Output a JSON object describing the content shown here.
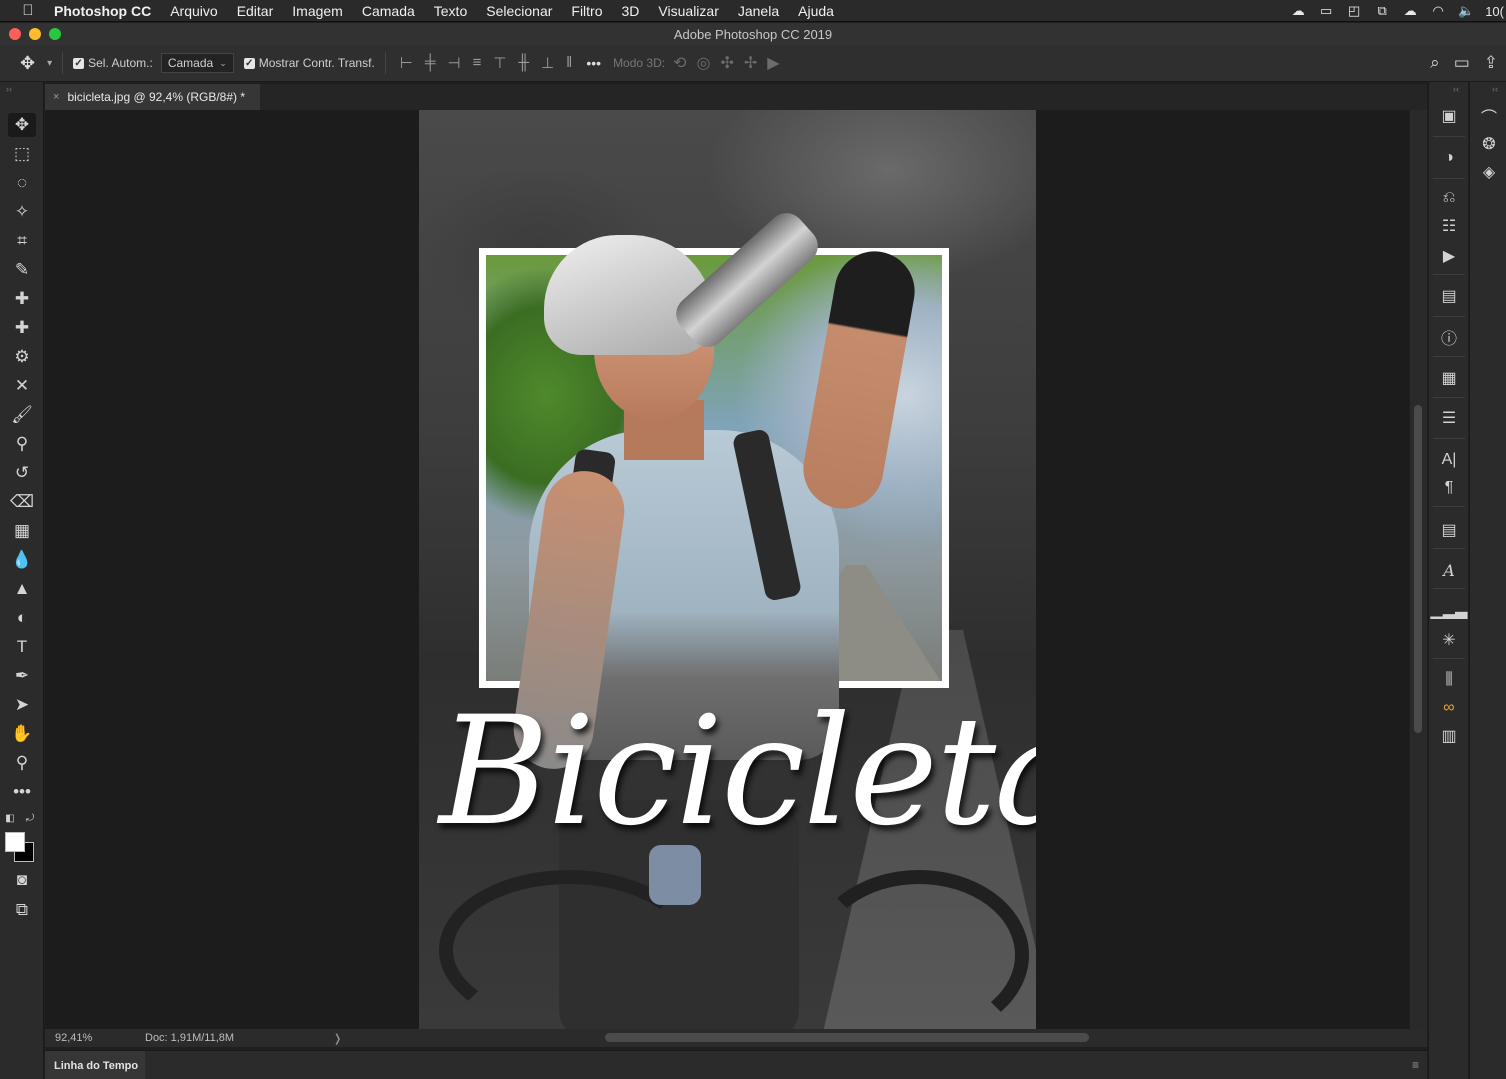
{
  "menubar": {
    "apple_icon": "apple-icon",
    "app_name": "Photoshop CC",
    "items": [
      "Arquivo",
      "Editar",
      "Imagem",
      "Camada",
      "Texto",
      "Selecionar",
      "Filtro",
      "3D",
      "Visualizar",
      "Janela",
      "Ajuda"
    ],
    "status_icons": [
      "creative-cloud-sync-icon",
      "screen-record-icon",
      "display-icon",
      "airplay-icon",
      "cloud-icon",
      "wifi-icon",
      "volume-icon"
    ],
    "status_text": "10("
  },
  "window": {
    "title": "Adobe Photoshop CC 2019",
    "traffic_lights": [
      "#fe5f57",
      "#febc2e",
      "#28c840"
    ]
  },
  "options": {
    "tool_icon": "move-tool-icon",
    "auto_select_label": "Sel. Autom.:",
    "auto_select_checked": true,
    "target_value": "Camada",
    "show_transform_label": "Mostrar Contr. Transf.",
    "show_transform_checked": true,
    "more_label": "•••",
    "mode_3d_label": "Modo 3D:",
    "right_icons": [
      "search-icon",
      "workspace-icon",
      "share-icon"
    ]
  },
  "document_tab": {
    "close": "×",
    "title": "bicicleta.jpg @ 92,4% (RGB/8#) *"
  },
  "tools": [
    "move",
    "rectangular-marquee",
    "lasso",
    "magic-wand",
    "crop",
    "eyedropper",
    "spot-healing",
    "healing",
    "patch",
    "content-aware-move",
    "brush",
    "clone-stamp",
    "history-brush",
    "eraser",
    "gradient",
    "blur",
    "sharpen",
    "dodge",
    "type",
    "pen",
    "path-selection",
    "hand",
    "zoom",
    "more",
    "default-colors",
    "swap-colors",
    "foreground-color",
    "background-color",
    "quick-mask",
    "screen-mode"
  ],
  "colors": {
    "foreground": "#ffffff",
    "background": "#000000",
    "panel": "#2b2b2b",
    "canvas": "#1c1c1c"
  },
  "artwork": {
    "title_text": "Bicicleta"
  },
  "status": {
    "zoom": "92,41%",
    "doc": "Doc: 1,91M/11,8M",
    "arrow": "❭"
  },
  "timeline": {
    "label": "Linha do Tempo"
  },
  "right_panels": [
    "libraries",
    "adjustments",
    "history",
    "properties",
    "actions",
    "notes",
    "info",
    "swatches-grid",
    "layer-comps",
    "character",
    "paragraph",
    "paragraph-styles",
    "glyphs",
    "histogram",
    "navigator",
    "measurement",
    "color-themes",
    "timeline-panel"
  ],
  "right_panels_2": [
    "paths",
    "channels",
    "layers"
  ]
}
